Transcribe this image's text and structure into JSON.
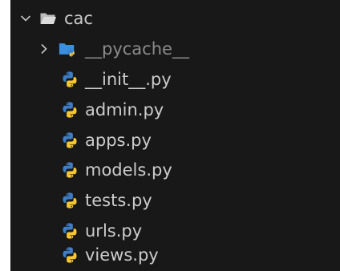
{
  "explorer": {
    "folder": {
      "name": "cac",
      "expanded": true,
      "icon": "folder-open-icon"
    },
    "subfolder": {
      "name": "__pycache__",
      "expanded": false,
      "icon": "folder-python-icon"
    },
    "files": [
      {
        "name": "__init__.py",
        "icon": "python-icon"
      },
      {
        "name": "admin.py",
        "icon": "python-icon"
      },
      {
        "name": "apps.py",
        "icon": "python-icon"
      },
      {
        "name": "models.py",
        "icon": "python-icon"
      },
      {
        "name": "tests.py",
        "icon": "python-icon"
      },
      {
        "name": "urls.py",
        "icon": "python-icon"
      },
      {
        "name": "views.py",
        "icon": "python-icon"
      }
    ],
    "colors": {
      "background": "#181818",
      "text": "#cccccc",
      "dim_text": "#8b8b8b",
      "python_blue": "#3f7dc4",
      "python_yellow": "#f5c632",
      "folder_gray": "#c5c5c5",
      "folder_blue": "#3a8fe0"
    }
  }
}
